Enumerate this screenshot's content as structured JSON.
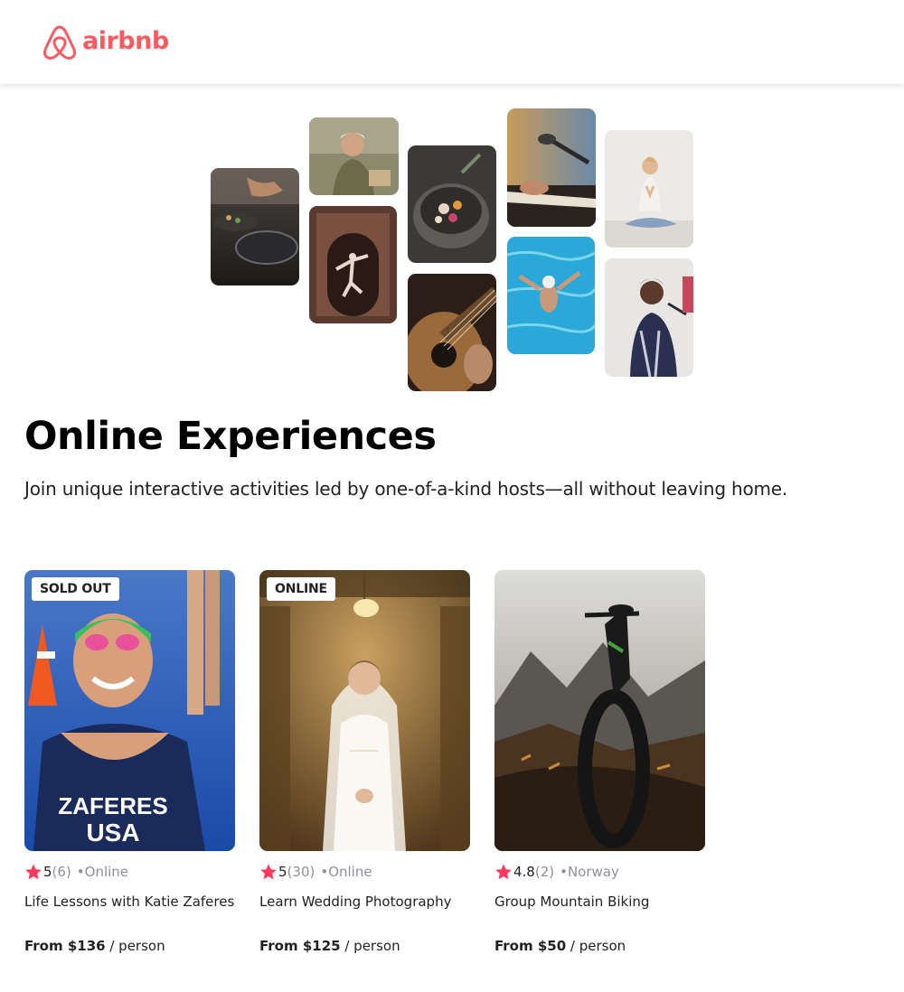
{
  "brand": {
    "name": "airbnb",
    "color": "#FF5A5F",
    "logo_icon": "airbnb-belo-icon"
  },
  "hero": {
    "title": "Online Experiences",
    "subtitle": "Join unique interactive activities led by one-of-a-kind hosts—all without leaving home."
  },
  "gallery": [
    {
      "name": "cooking-photo"
    },
    {
      "name": "woman-portrait-photo"
    },
    {
      "name": "dancer-photo"
    },
    {
      "name": "food-bowl-photo"
    },
    {
      "name": "guitar-photo"
    },
    {
      "name": "keyboard-microphone-photo"
    },
    {
      "name": "swimmer-photo"
    },
    {
      "name": "yoga-photo"
    },
    {
      "name": "singer-photo"
    }
  ],
  "star_color": "#FE385C",
  "cards": [
    {
      "badge": "SOLD OUT",
      "rating": "5",
      "count": "(6)",
      "location": "•Online",
      "title": "Life Lessons with Katie Zaferes",
      "price_label": "From $136",
      "price_unit": " / person"
    },
    {
      "badge": "ONLINE",
      "rating": "5",
      "count": "(30)",
      "location": "•Online",
      "title": "Learn Wedding Photography",
      "price_label": "From $125",
      "price_unit": " / person"
    },
    {
      "badge": "",
      "rating": "4.8",
      "count": "(2)",
      "location": "•Norway",
      "title": "Group Mountain Biking",
      "price_label": "From $50",
      "price_unit": " / person"
    }
  ]
}
